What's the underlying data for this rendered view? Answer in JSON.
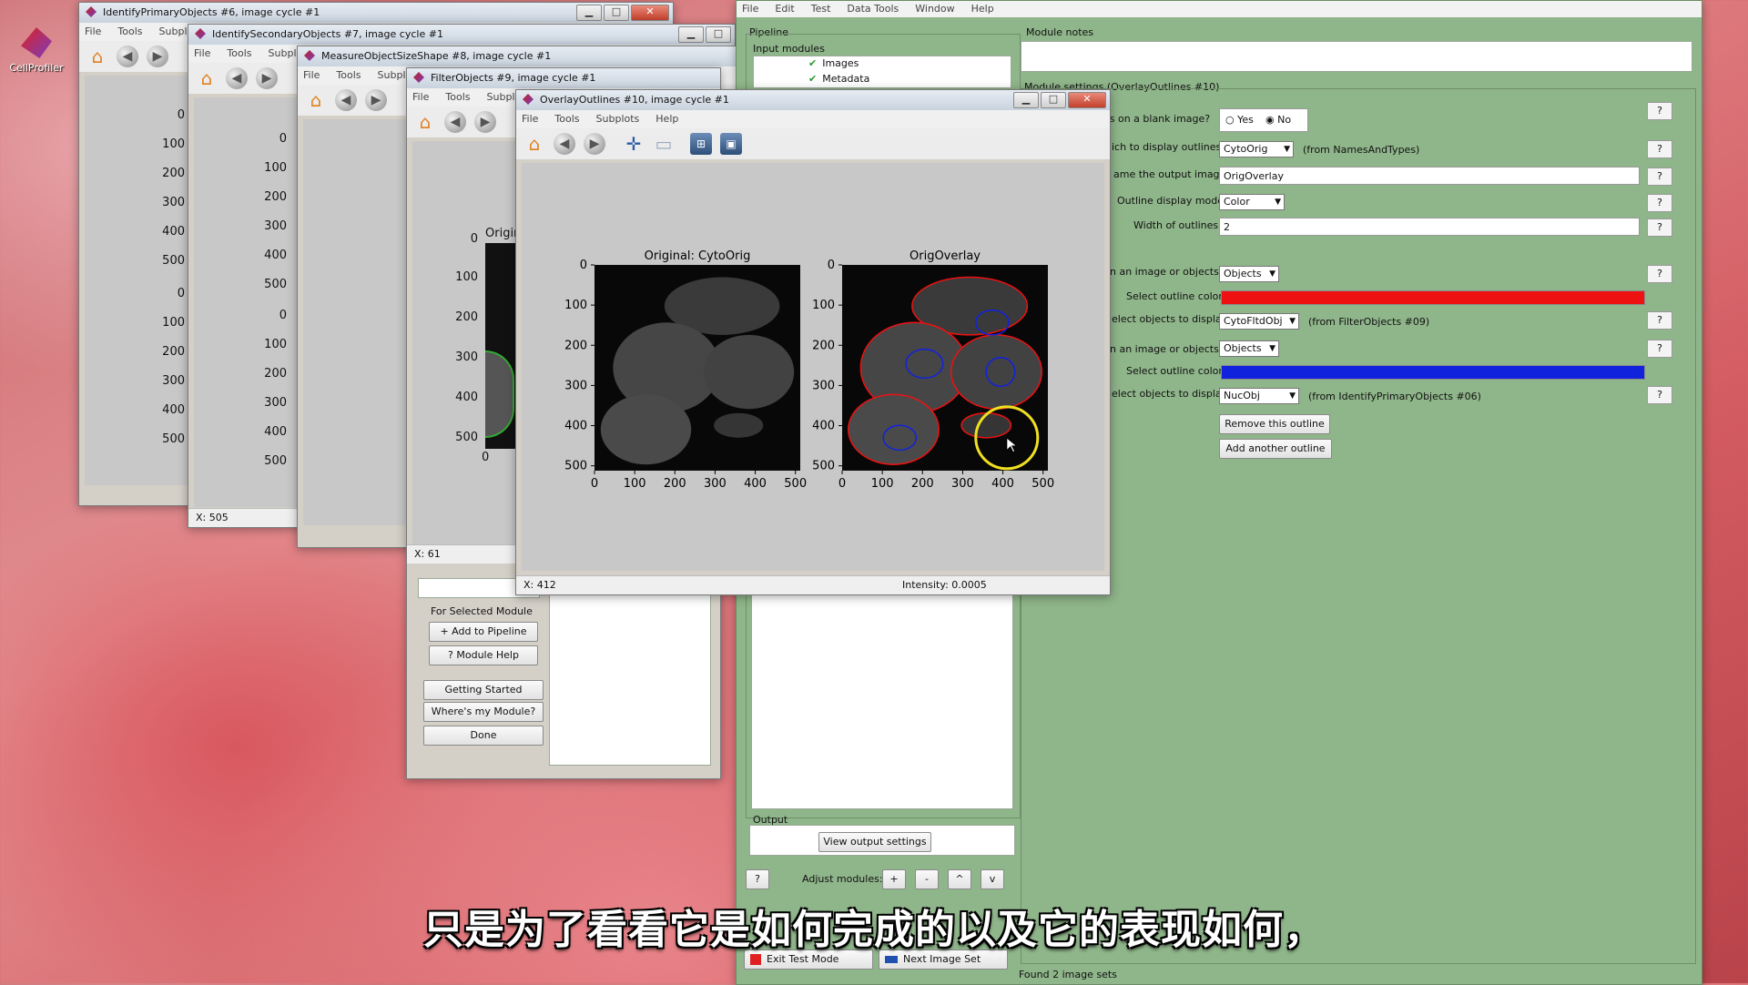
{
  "desktop": {
    "icon_label": "CellProfiler"
  },
  "windows": {
    "w6": {
      "title": "IdentifyPrimaryObjects #6, image cycle #1",
      "menu": [
        "File",
        "Tools",
        "Subplots"
      ],
      "yticks": [
        "0",
        "100",
        "200",
        "300",
        "400",
        "500",
        "0",
        "100",
        "200",
        "300",
        "400",
        "500"
      ]
    },
    "w7": {
      "title": "IdentifySecondaryObjects #7, image cycle #1",
      "menu": [
        "File",
        "Tools",
        "Subplots"
      ],
      "yticks": [
        "0",
        "100",
        "200",
        "300",
        "400",
        "500",
        "0",
        "100",
        "200",
        "300",
        "400",
        "500"
      ],
      "status": "X: 505"
    },
    "w8": {
      "title": "MeasureObjectSizeShape #8, image cycle #1",
      "menu": [
        "File",
        "Tools",
        "Subplots"
      ]
    },
    "w9": {
      "title": "FilterObjects #9, image cycle #1",
      "menu": [
        "File",
        "Tools",
        "Subplots"
      ],
      "partial_title": "Origin",
      "yticks": [
        "0",
        "100",
        "200",
        "300",
        "400",
        "500"
      ],
      "xtick0": "0",
      "status": "X: 61"
    },
    "w10": {
      "title": "OverlayOutlines #10, image cycle #1",
      "menu": [
        "File",
        "Tools",
        "Subplots",
        "Help"
      ],
      "status_x": "X: 412",
      "status_intensity": "Intensity: 0.0005"
    }
  },
  "chart_data": [
    {
      "type": "image",
      "title": "Original: CytoOrig",
      "xticks": [
        0,
        100,
        200,
        300,
        400,
        500
      ],
      "yticks": [
        0,
        100,
        200,
        300,
        400,
        500
      ],
      "xlim": [
        0,
        512
      ],
      "ylim": [
        512,
        0
      ]
    },
    {
      "type": "image",
      "title": "OrigOverlay",
      "xticks": [
        0,
        100,
        200,
        300,
        400,
        500
      ],
      "yticks": [
        0,
        100,
        200,
        300,
        400,
        500
      ],
      "xlim": [
        0,
        512
      ],
      "ylim": [
        512,
        0
      ]
    }
  ],
  "module_browser": {
    "section_label": "For Selected Module",
    "add_button": "+ Add to Pipeline",
    "help_button": "? Module Help",
    "getting_started": "Getting Started",
    "where_module": "Where's my Module?",
    "done": "Done"
  },
  "main": {
    "menu": [
      "File",
      "Edit",
      "Test",
      "Data Tools",
      "Window",
      "Help"
    ],
    "pipeline_label": "Pipeline",
    "input_modules_label": "Input modules",
    "input_modules": [
      "Images",
      "Metadata"
    ],
    "output_label": "Output",
    "view_output": "View output settings",
    "adjust_label": "Adjust modules:",
    "adjust_buttons": [
      "+",
      "-",
      "^",
      "v"
    ],
    "help_q": "?",
    "exit_test": "Exit Test Mode",
    "next_image": "Next Image Set",
    "module_notes_label": "Module notes",
    "module_settings_label": "Module settings (OverlayOutlines #10)",
    "found_sets": "Found 2 image sets",
    "settings": {
      "blank_label": "nes on a blank image?",
      "yes": "Yes",
      "no": "No",
      "display_label": "ich to display outlines",
      "display_value": "CytoOrig",
      "display_note": "(from NamesAndTypes)",
      "output_label": "ame the output image",
      "output_value": "OrigOverlay",
      "mode_label": "Outline display mode",
      "mode_value": "Color",
      "width_label": "Width of outlines",
      "width_value": "2",
      "kind1_label": "n an image or objects?",
      "kind1_value": "Objects",
      "color1_label": "Select outline color",
      "color1": "#ee1111",
      "obj1_label": "elect objects to display",
      "obj1_value": "CytoFltdObj",
      "obj1_note": "(from FilterObjects #09)",
      "kind2_label": "n an image or objects?",
      "kind2_value": "Objects",
      "color2_label": "Select outline color",
      "color2": "#1122dd",
      "obj2_label": "elect objects to display",
      "obj2_value": "NucObj",
      "obj2_note": "(from IdentifyPrimaryObjects #06)",
      "remove": "Remove this outline",
      "add": "Add another outline",
      "q": "?"
    }
  },
  "subtitle": "只是为了看看它是如何完成的以及它的表现如何，"
}
